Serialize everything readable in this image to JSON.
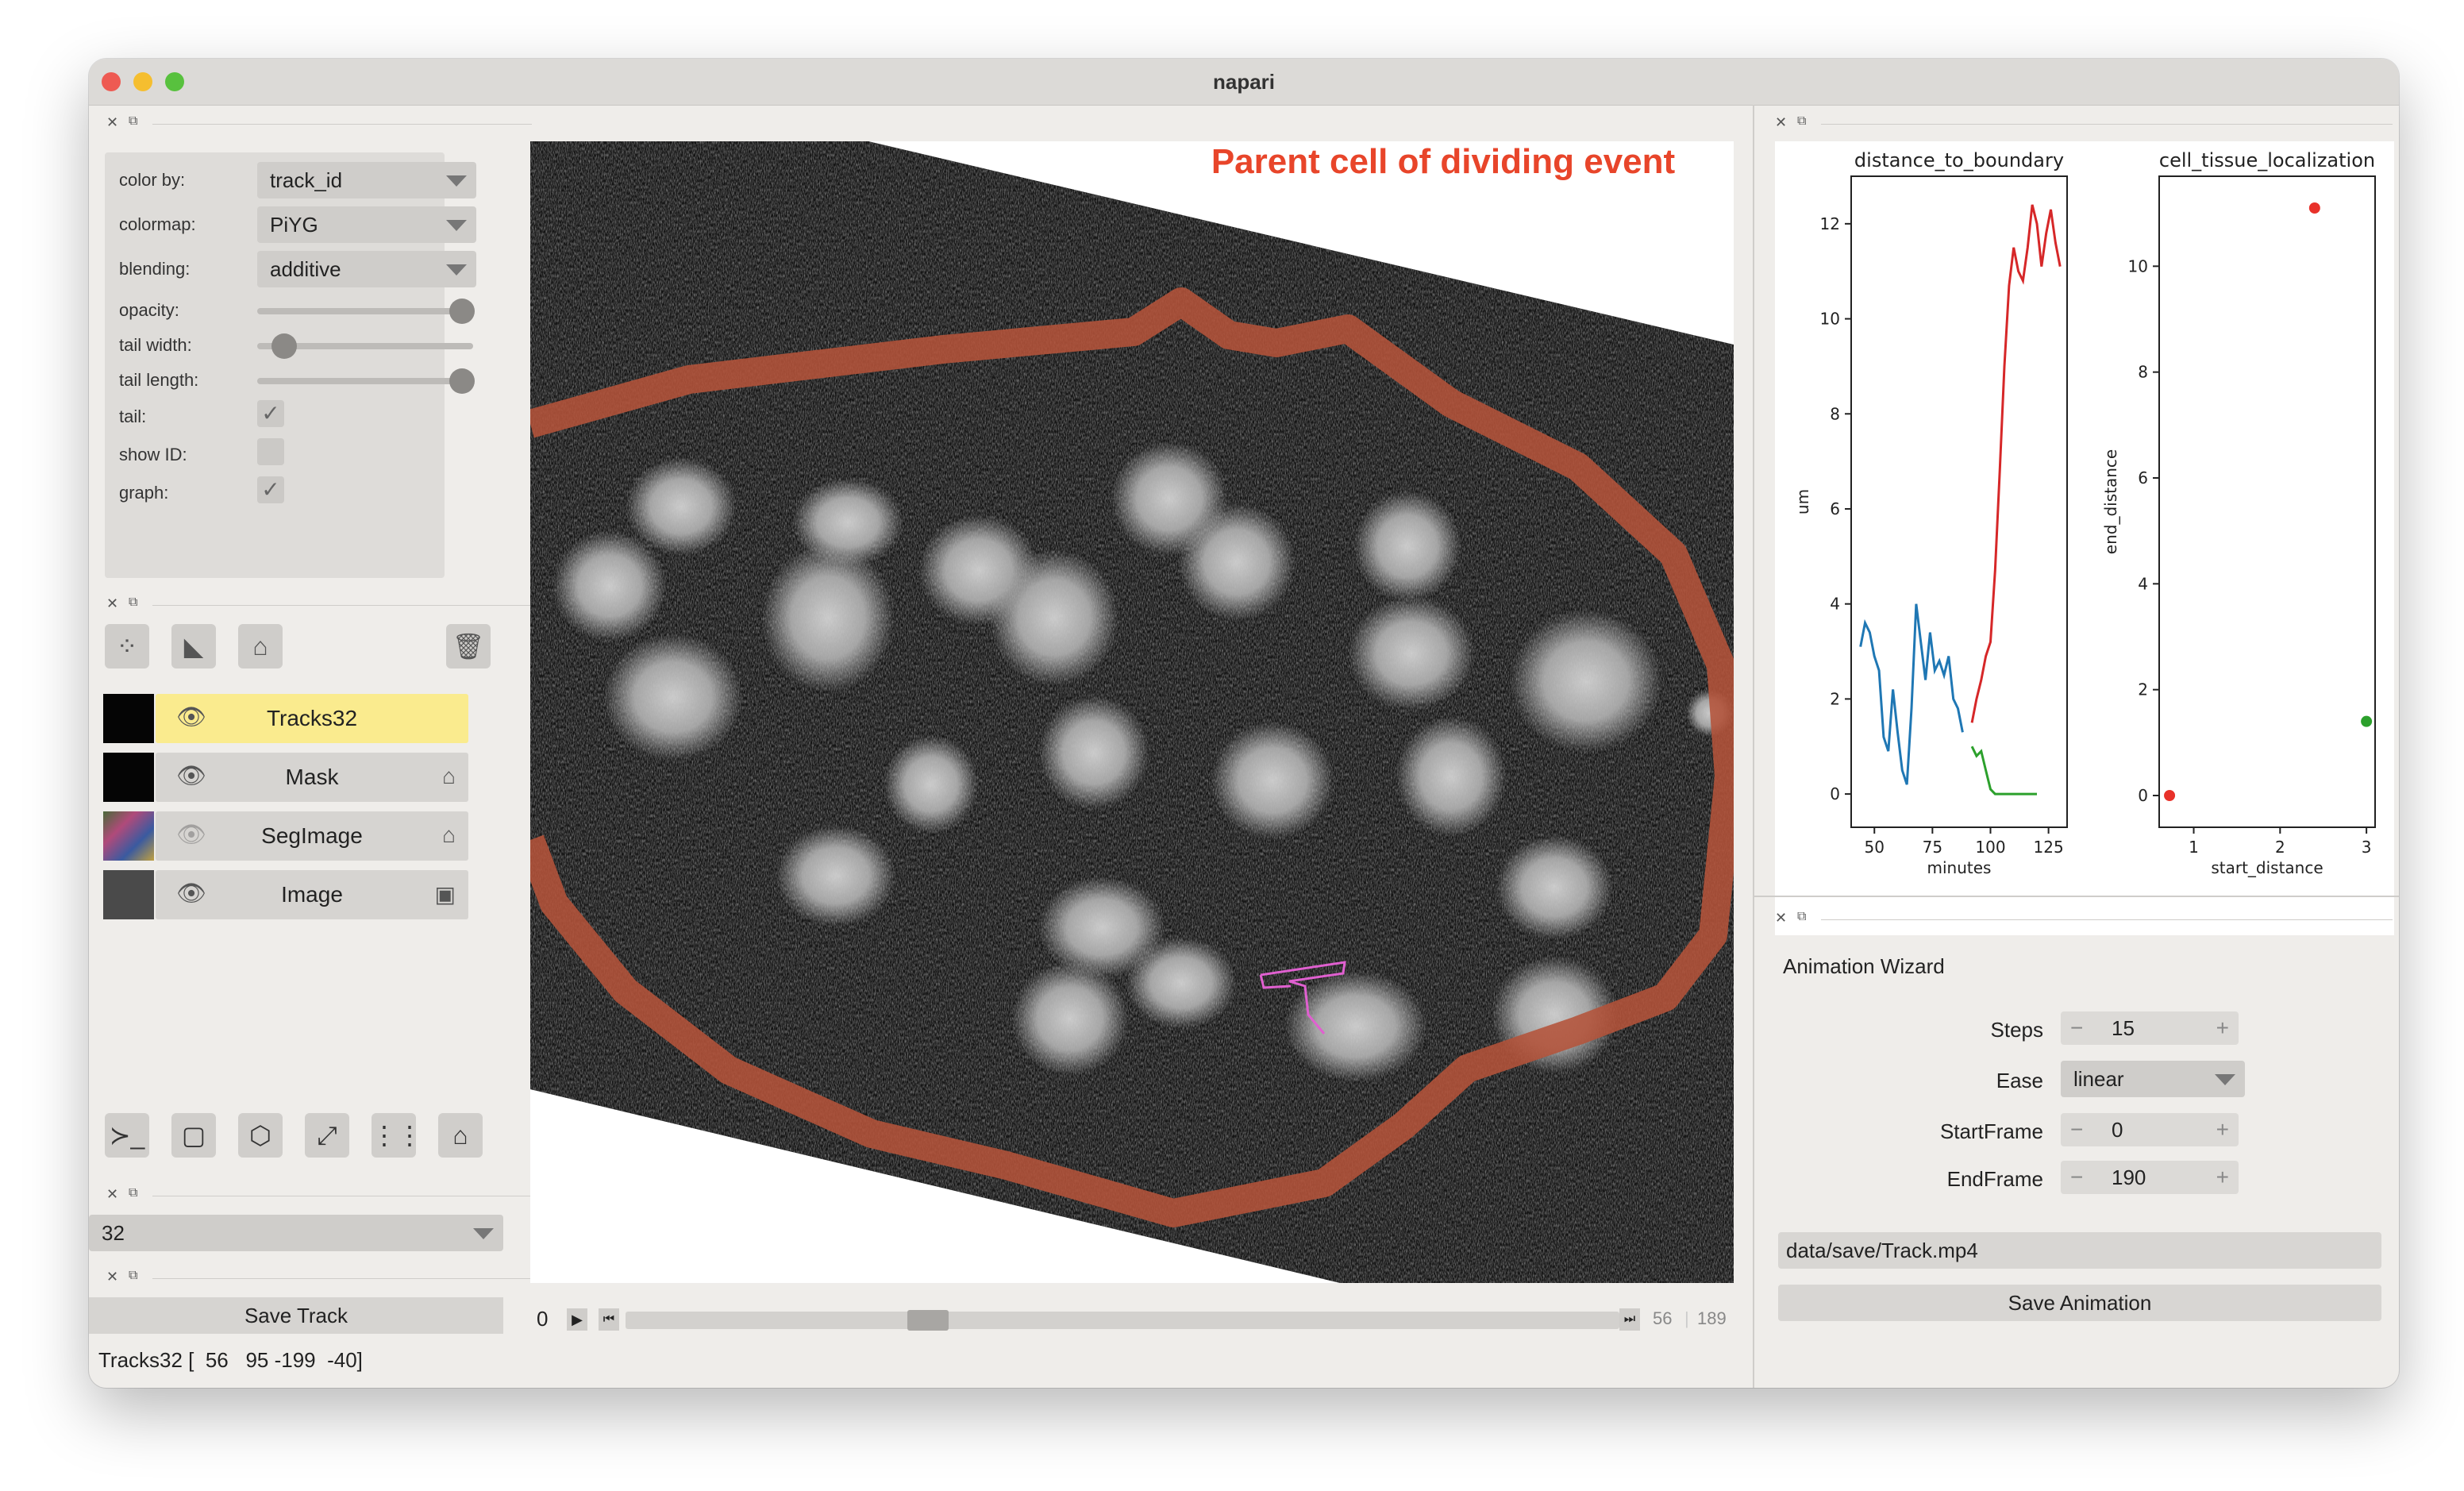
{
  "window": {
    "title": "napari"
  },
  "layer_controls": {
    "color_by_label": "color by:",
    "color_by_value": "track_id",
    "colormap_label": "colormap:",
    "colormap_value": "PiYG",
    "blending_label": "blending:",
    "blending_value": "additive",
    "opacity_label": "opacity:",
    "opacity_value": 1.0,
    "tail_width_label": "tail width:",
    "tail_width_value": 0.1,
    "tail_length_label": "tail length:",
    "tail_length_value": 1.0,
    "tail_label": "tail:",
    "tail_checked": true,
    "show_id_label": "show ID:",
    "show_id_checked": false,
    "graph_label": "graph:",
    "graph_checked": true
  },
  "layers": [
    {
      "name": "Tracks32",
      "visible": true,
      "selected": true,
      "type_icon": ""
    },
    {
      "name": "Mask",
      "visible": true,
      "selected": false,
      "type_icon": "label-tag-icon"
    },
    {
      "name": "SegImage",
      "visible": false,
      "selected": false,
      "type_icon": "label-tag-icon"
    },
    {
      "name": "Image",
      "visible": true,
      "selected": false,
      "type_icon": "image-icon"
    }
  ],
  "track_selector": {
    "value": "32"
  },
  "save_track": {
    "label": "Save Track"
  },
  "status_bar": {
    "text": "Tracks32 [  56   95 -199  -40]"
  },
  "viewer": {
    "annotation": "Parent cell of dividing event"
  },
  "dims": {
    "current": "0",
    "frame": "56",
    "total": "189",
    "slider_fraction": 0.296
  },
  "charts": {
    "chart_data": [
      {
        "type": "line",
        "title": "distance_to_boundary",
        "xlabel": "minutes",
        "ylabel": "um",
        "xlim": [
          40,
          133
        ],
        "ylim": [
          -0.7,
          13
        ],
        "xticks": [
          "50",
          "75",
          "100",
          "125"
        ],
        "yticks": [
          "0",
          "2",
          "4",
          "6",
          "8",
          "10",
          "12"
        ],
        "series": [
          {
            "color": "#1f77b4",
            "x": [
              44,
              46,
              48,
              50,
              52,
              54,
              56,
              58,
              60,
              62,
              64,
              66,
              68,
              70,
              72,
              74,
              76,
              78,
              80,
              82,
              84,
              86,
              88
            ],
            "y": [
              3.1,
              3.6,
              3.4,
              2.9,
              2.6,
              1.2,
              0.9,
              2.2,
              1.3,
              0.5,
              0.2,
              1.8,
              4.0,
              3.2,
              2.4,
              3.4,
              2.6,
              2.8,
              2.5,
              2.9,
              2.0,
              1.8,
              1.3
            ]
          },
          {
            "color": "#d62728",
            "x": [
              92,
              94,
              96,
              98,
              100,
              102,
              104,
              106,
              108,
              110,
              112,
              114,
              116,
              118,
              120,
              122,
              124,
              126,
              128,
              130
            ],
            "y": [
              1.5,
              2.0,
              2.4,
              2.9,
              3.2,
              4.7,
              6.8,
              9.0,
              10.7,
              11.5,
              11.0,
              10.8,
              11.5,
              12.4,
              12.0,
              11.1,
              11.8,
              12.3,
              11.6,
              11.1
            ]
          },
          {
            "color": "#2ca02c",
            "x": [
              92,
              94,
              96,
              98,
              100,
              102,
              104,
              106,
              108,
              110,
              112,
              114,
              116,
              118,
              120
            ],
            "y": [
              1.0,
              0.8,
              0.9,
              0.5,
              0.1,
              0.0,
              0.0,
              0.0,
              0.0,
              0.0,
              0.0,
              0.0,
              0.0,
              0.0,
              0.0
            ]
          }
        ]
      },
      {
        "type": "scatter",
        "title": "cell_tissue_localization",
        "xlabel": "start_distance",
        "ylabel": "end_distance",
        "xlim": [
          0.6,
          3.1
        ],
        "ylim": [
          -0.6,
          11.7
        ],
        "xticks": [
          "1",
          "2",
          "3"
        ],
        "yticks": [
          "0",
          "2",
          "4",
          "6",
          "8",
          "10"
        ],
        "points": [
          {
            "x": 0.72,
            "y": 0.0,
            "color": "#e8312a"
          },
          {
            "x": 2.4,
            "y": 11.1,
            "color": "#e8312a"
          },
          {
            "x": 3.0,
            "y": 1.4,
            "color": "#2ca02c"
          }
        ]
      }
    ]
  },
  "animation_wizard": {
    "title": "Animation Wizard",
    "steps_label": "Steps",
    "steps_value": "15",
    "ease_label": "Ease",
    "ease_value": "linear",
    "start_label": "StartFrame",
    "start_value": "0",
    "end_label": "EndFrame",
    "end_value": "190",
    "path_value": "data/save/Track.mp4",
    "save_label": "Save Animation"
  },
  "colors": {
    "selected_layer": "#faeb8e",
    "annotation": "#e8452a",
    "boundary": "#b4533a",
    "track": "#e060d0"
  }
}
